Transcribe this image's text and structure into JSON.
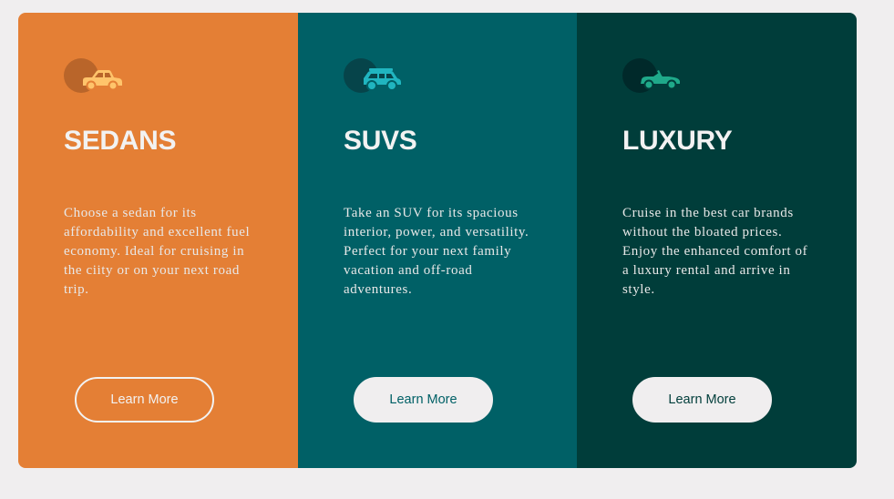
{
  "cards": [
    {
      "title": "SEDANS",
      "description": "Choose a sedan for its affordability and excellent fuel economy. Ideal for cruising in the ciity or on your next road trip.",
      "button_label": "Learn More",
      "icon": "sedan-car-icon",
      "background": "#e47f35",
      "icon_color": "#ffc46b"
    },
    {
      "title": "SUVS",
      "description": "Take an SUV for its spacious interior, power, and versatility. Perfect for your next family vacation and off-road adventures.",
      "button_label": "Learn More",
      "icon": "suv-car-icon",
      "background": "#006066",
      "icon_color": "#20b5c0"
    },
    {
      "title": "LUXURY",
      "description": "Cruise in the best car brands without the bloated prices. Enjoy the enhanced comfort of a luxury rental and arrive in style.",
      "button_label": "Learn More",
      "icon": "luxury-car-icon",
      "background": "#003d3a",
      "icon_color": "#1fa98a"
    }
  ],
  "page_background": "#f0eeef"
}
